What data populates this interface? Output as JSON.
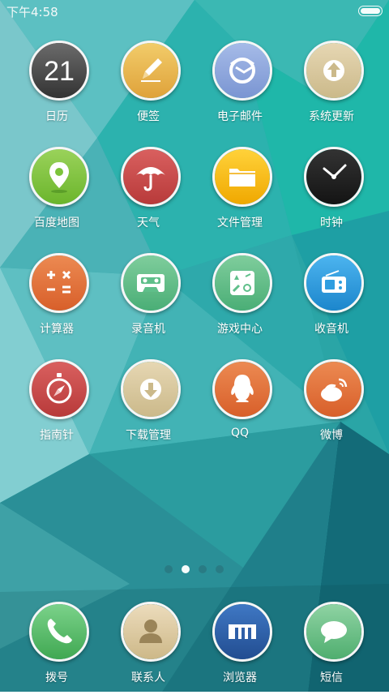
{
  "status_bar": {
    "time": "下午4:58"
  },
  "apps": [
    {
      "label": "日历",
      "icon": "calendar-icon",
      "day": "21"
    },
    {
      "label": "便签",
      "icon": "notes-icon"
    },
    {
      "label": "电子邮件",
      "icon": "email-icon"
    },
    {
      "label": "系统更新",
      "icon": "system-update-icon"
    },
    {
      "label": "百度地图",
      "icon": "map-pin-icon"
    },
    {
      "label": "天气",
      "icon": "umbrella-icon"
    },
    {
      "label": "文件管理",
      "icon": "folder-icon"
    },
    {
      "label": "时钟",
      "icon": "clock-icon"
    },
    {
      "label": "计算器",
      "icon": "calculator-icon"
    },
    {
      "label": "录音机",
      "icon": "cassette-icon"
    },
    {
      "label": "游戏中心",
      "icon": "game-center-icon"
    },
    {
      "label": "收音机",
      "icon": "radio-icon"
    },
    {
      "label": "指南针",
      "icon": "compass-icon"
    },
    {
      "label": "下载管理",
      "icon": "download-icon"
    },
    {
      "label": "QQ",
      "icon": "qq-penguin-icon"
    },
    {
      "label": "微博",
      "icon": "weibo-icon"
    }
  ],
  "page_indicator": {
    "count": 4,
    "active_index": 1
  },
  "dock": [
    {
      "label": "拨号",
      "icon": "phone-icon"
    },
    {
      "label": "联系人",
      "icon": "contacts-icon"
    },
    {
      "label": "浏览器",
      "icon": "browser-icon"
    },
    {
      "label": "短信",
      "icon": "message-icon"
    }
  ],
  "colors": {
    "calendar": "#4a4a4a",
    "notes": "#e8b54a",
    "email": "#8fa7dd",
    "update": "#d9c89e",
    "map": "#7cc43a",
    "weather": "#cf4d4d",
    "files": "#f5b800",
    "clock": "#1e1e1e",
    "calculator": "#e2703a",
    "recorder": "#5fbf8a",
    "game": "#5fbf8a",
    "radio": "#2f9ee0",
    "compass": "#cf4d4d",
    "download": "#d9c89e",
    "qq": "#e2703a",
    "weibo": "#e2703a",
    "phone": "#5cbf6a",
    "contacts": "#d9c89e",
    "browser": "#2f5fa8",
    "message": "#6ac48a"
  }
}
